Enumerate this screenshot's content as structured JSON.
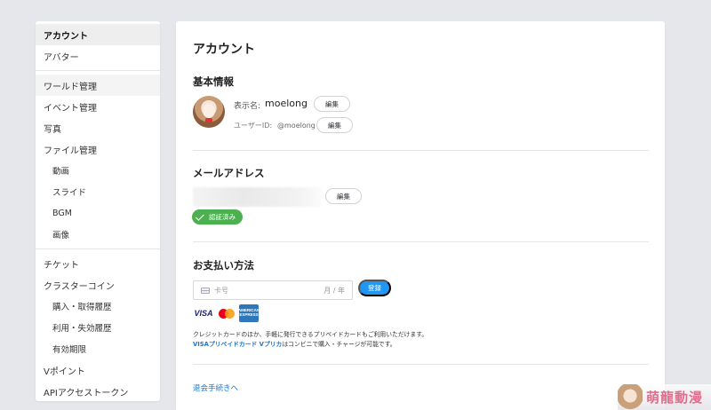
{
  "sidebar": {
    "items": [
      {
        "label": "アカウント"
      },
      {
        "label": "アバター"
      },
      {
        "label": "ワールド管理"
      },
      {
        "label": "イベント管理"
      },
      {
        "label": "写真"
      },
      {
        "label": "ファイル管理"
      },
      {
        "label": "動画"
      },
      {
        "label": "スライド"
      },
      {
        "label": "BGM"
      },
      {
        "label": "画像"
      },
      {
        "label": "チケット"
      },
      {
        "label": "クラスターコイン"
      },
      {
        "label": "購入・取得履歴"
      },
      {
        "label": "利用・失効履歴"
      },
      {
        "label": "有効期限"
      },
      {
        "label": "Vポイント"
      },
      {
        "label": "APIアクセストークン"
      }
    ]
  },
  "main": {
    "title": "アカウント",
    "basic": {
      "heading": "基本情報",
      "display_name_label": "表示名:",
      "display_name": "moelong",
      "user_id_label": "ユーザーID:",
      "user_id": "@moelong",
      "edit_label": "編集"
    },
    "email": {
      "heading": "メールアドレス",
      "edit_label": "編集",
      "verified_label": "認証済み"
    },
    "payment": {
      "heading": "お支払い方法",
      "card_number_placeholder": "卡号",
      "expiry_placeholder": "月 / 年",
      "register_label": "登録",
      "brands": [
        "VISA",
        "mastercard",
        "AMERICAN EXPRESS"
      ],
      "note_line1": "クレジットカードのほか、手軽に発行できるプリペイドカードもご利用いただけます。",
      "note_link": "VISAプリペイドカード Vプリカ",
      "note_line2_rest": "はコンビニで購入・チャージが可能です。"
    },
    "withdraw_link": "退会手続きへ"
  },
  "watermark": {
    "text": "萌龍動漫"
  },
  "colors": {
    "accent": "#2196f3",
    "verified": "#4caf50",
    "link": "#1976d2",
    "background": "#e6e7ea"
  }
}
